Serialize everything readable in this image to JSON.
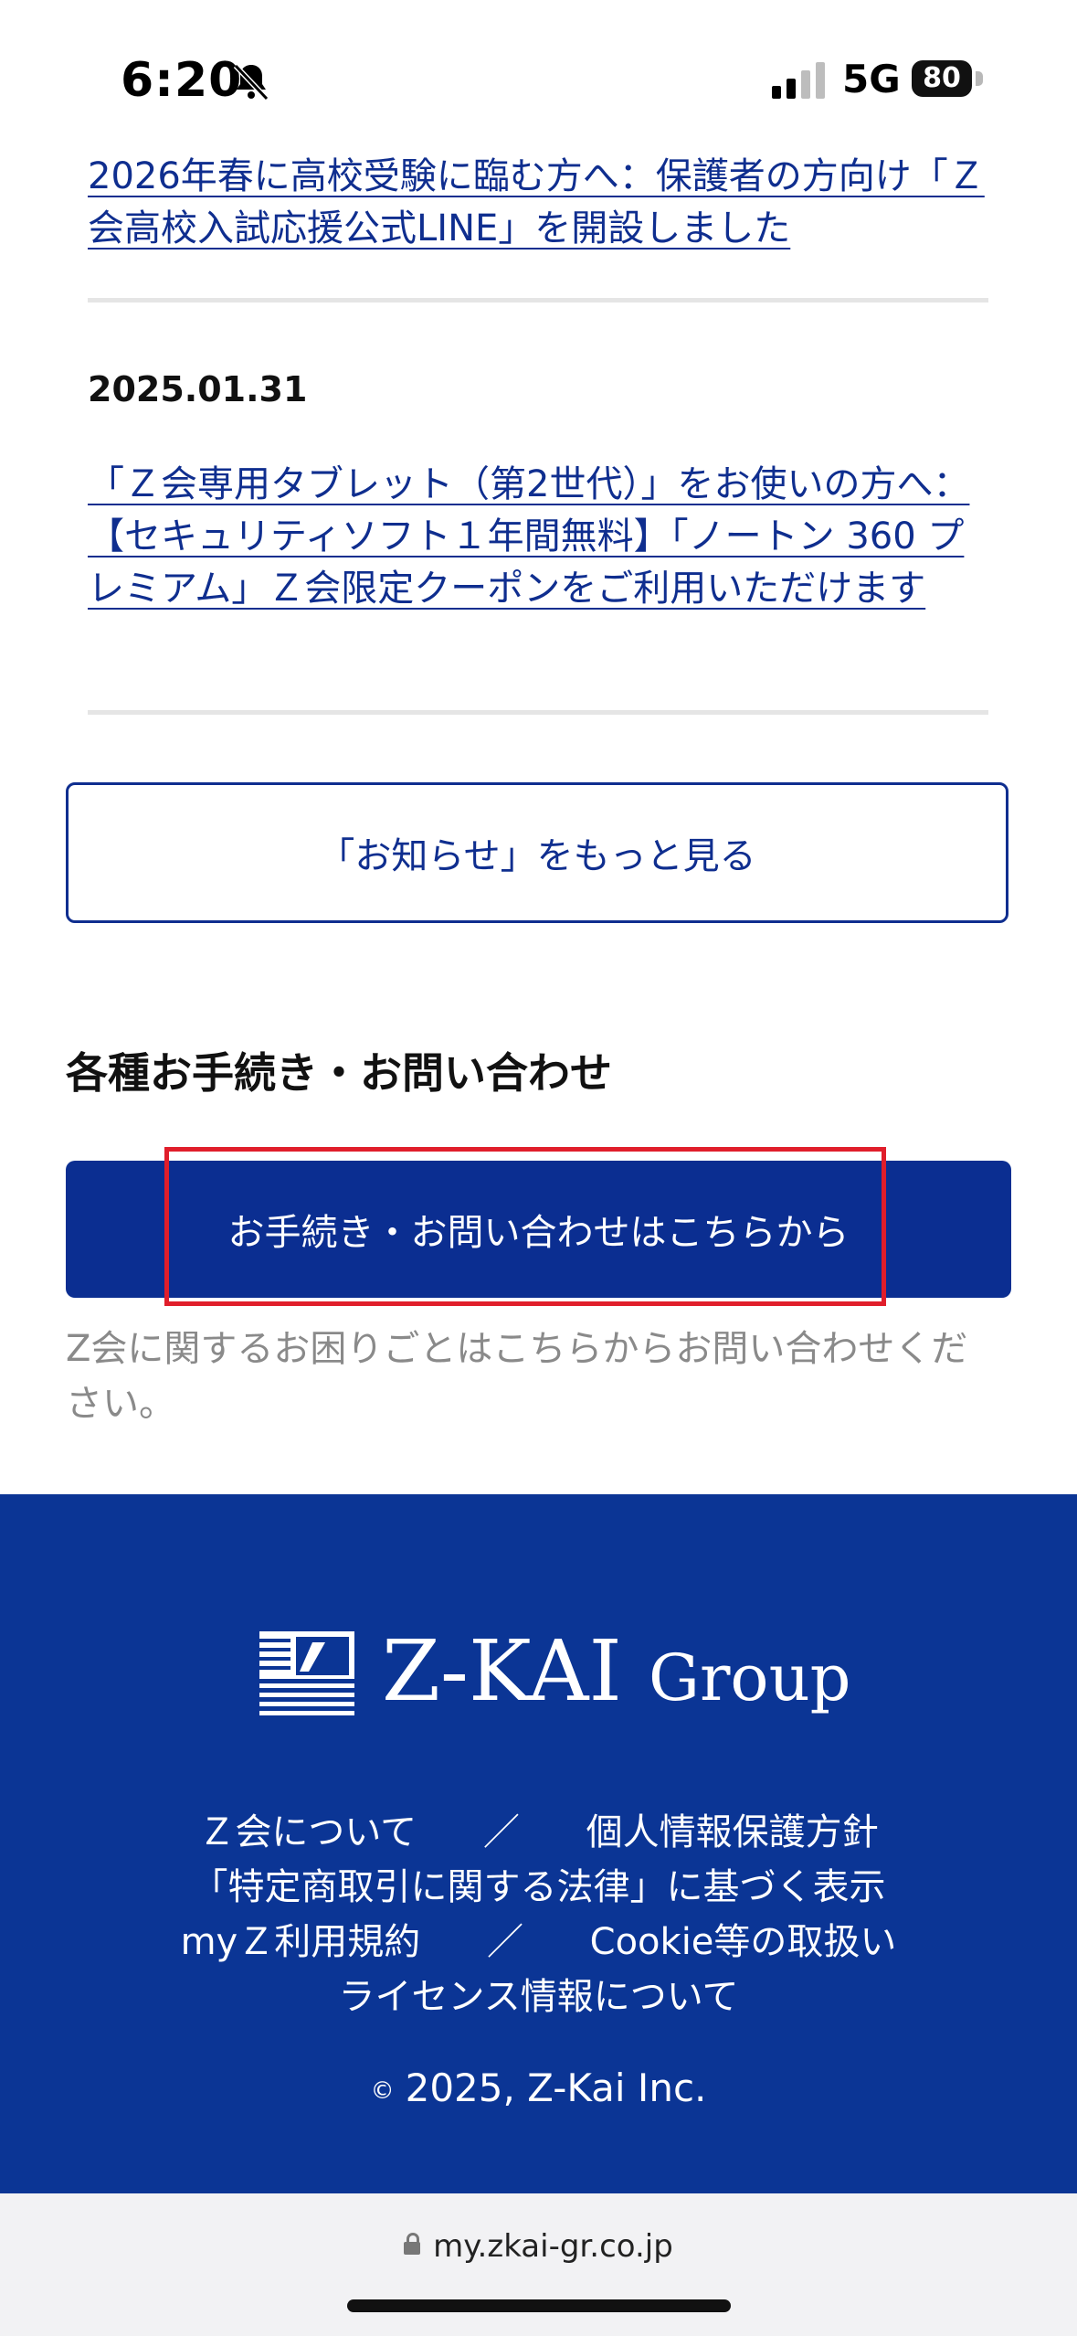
{
  "status_bar": {
    "time": "6:20",
    "network": "5G",
    "battery": "80"
  },
  "news": [
    {
      "title": "2026年春に高校受験に臨む方へ：保護者の方向け「Ｚ会高校入試応援公式LINE」を開設しました"
    },
    {
      "date": "2025.01.31",
      "title": "「Ｚ会専用タブレット（第2世代）」をお使いの方へ：【セキュリティソフト１年間無料】「ノートン 360 プレミアム」Ｚ会限定クーポンをご利用いただけます"
    }
  ],
  "more_news_button": "「お知らせ」をもっと見る",
  "procedures": {
    "title": "各種お手続き・お問い合わせ",
    "button": "お手続き・お問い合わせはこちらから",
    "description": "Z会に関するお困りごとはこちらからお問い合わせください。"
  },
  "footer": {
    "logo_main": "Z-KAI",
    "logo_sub": "Group",
    "link_about": "Ｚ会について",
    "separator": "／",
    "link_privacy": "個人情報保護方針",
    "link_commerce": "「特定商取引に関する法律」に基づく表示",
    "link_terms": "myＺ利用規約",
    "link_cookie": "Cookie等の取扱い",
    "link_license": "ライセンス情報について",
    "copyright_symbol": "©",
    "copyright": "2025, Z-Kai Inc."
  },
  "browser": {
    "url": "my.zkai-gr.co.jp"
  }
}
